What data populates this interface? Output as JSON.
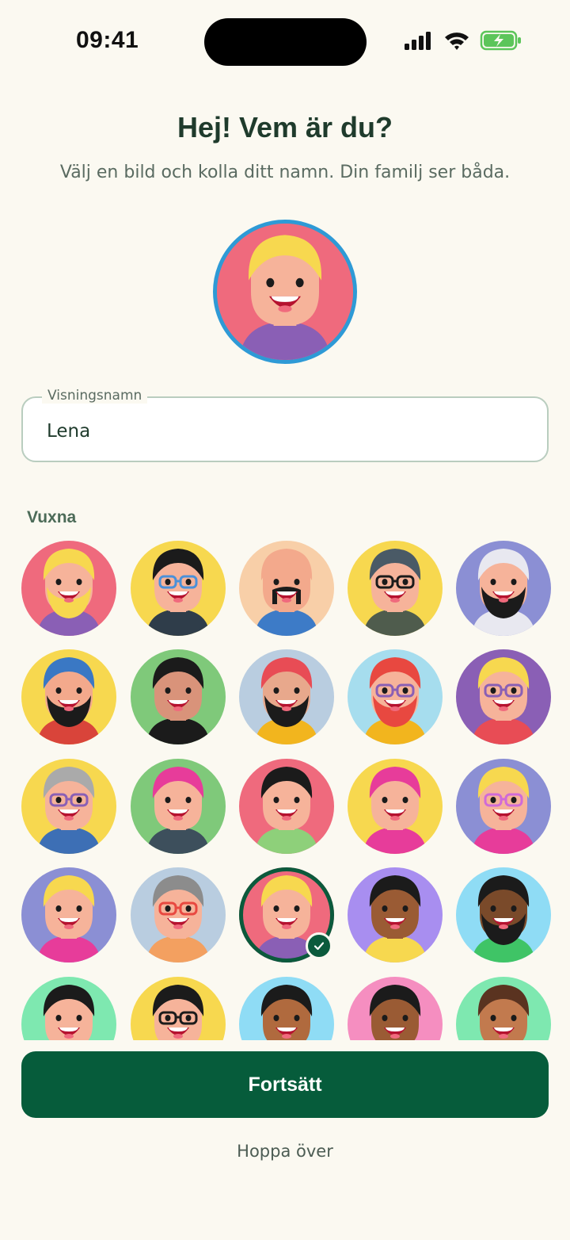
{
  "status_bar": {
    "time": "09:41",
    "icons": [
      "signal-icon",
      "wifi-icon",
      "battery-charging-icon"
    ]
  },
  "header": {
    "title": "Hej! Vem är du?",
    "subtitle": "Välj en bild och kolla ditt namn. Din familj ser båda."
  },
  "name_field": {
    "label": "Visningsnamn",
    "value": "Lena"
  },
  "section": {
    "label": "Vuxna"
  },
  "avatars": [
    {
      "bg": "#ef6a7d",
      "skin": "#f6b39a",
      "hair": "#f7d84f",
      "shirt": "#8a5fb5",
      "beard": "#f7d84f"
    },
    {
      "bg": "#f7d84f",
      "skin": "#f6b39a",
      "hair": "#1b1b1b",
      "shirt": "#2f3d4a",
      "glasses": "#4a90d9"
    },
    {
      "bg": "#f8cfa8",
      "skin": "#f3a98c",
      "hair": "#f3a98c",
      "shirt": "#3d7bc7",
      "mustache": "#1b1b1b"
    },
    {
      "bg": "#f7d84f",
      "skin": "#f6b39a",
      "hair": "#4a5a66",
      "shirt": "#4f5c4d",
      "glasses": "#1b1b1b"
    },
    {
      "bg": "#8b8fd4",
      "skin": "#f6b39a",
      "hair": "#e8e8f0",
      "shirt": "#e8e8f0",
      "beard": "#1b1b1b"
    },
    {
      "bg": "#f7d84f",
      "skin": "#f3a98c",
      "hair": "#3a78c4",
      "shirt": "#d9443a",
      "beard": "#1b1b1b"
    },
    {
      "bg": "#7fc97a",
      "skin": "#d9937a",
      "hair": "#1b1b1b",
      "shirt": "#1b1b1b"
    },
    {
      "bg": "#b9cde0",
      "skin": "#e8a88c",
      "hair": "#e84c55",
      "shirt": "#f2b51e",
      "beard": "#1b1b1b"
    },
    {
      "bg": "#a6ddee",
      "skin": "#f6b39a",
      "hair": "#e84840",
      "shirt": "#f2b51e",
      "beard": "#e84840",
      "glasses": "#8a5fb5"
    },
    {
      "bg": "#8a5fb5",
      "skin": "#f6b39a",
      "hair": "#f7d84f",
      "shirt": "#e84c55",
      "glasses": "#8a5fb5"
    },
    {
      "bg": "#f7d84f",
      "skin": "#f6b39a",
      "hair": "#aaaaaa",
      "shirt": "#3d6fb5",
      "glasses": "#8a5fb5"
    },
    {
      "bg": "#7fc97a",
      "skin": "#f6b39a",
      "hair": "#e73c9a",
      "shirt": "#3d4f5c"
    },
    {
      "bg": "#ef6a7d",
      "skin": "#f6b39a",
      "hair": "#1b1b1b",
      "shirt": "#8ed07a"
    },
    {
      "bg": "#f7d84f",
      "skin": "#f6b39a",
      "hair": "#e73c9a",
      "shirt": "#e73c9a"
    },
    {
      "bg": "#8b8fd4",
      "skin": "#f6b39a",
      "hair": "#f7d84f",
      "shirt": "#e73c9a",
      "glasses": "#d06ad8"
    },
    {
      "bg": "#8b8fd4",
      "skin": "#f6b39a",
      "hair": "#f7d84f",
      "shirt": "#e73c9a"
    },
    {
      "bg": "#b9cde0",
      "skin": "#f6b39a",
      "hair": "#8c8c8c",
      "shirt": "#f3a060",
      "glasses": "#e84840"
    },
    {
      "bg": "#ef6a7d",
      "skin": "#f6b39a",
      "hair": "#f7d84f",
      "shirt": "#8a5fb5",
      "selected": true
    },
    {
      "bg": "#a88ef0",
      "skin": "#9a5b34",
      "hair": "#1b1b1b",
      "shirt": "#f7d84f"
    },
    {
      "bg": "#8fdcf5",
      "skin": "#7a4a2a",
      "hair": "#1b1b1b",
      "shirt": "#3fc466",
      "beard": "#1b1b1b"
    },
    {
      "bg": "#7ee8b0",
      "skin": "#f6b39a",
      "hair": "#1b1b1b",
      "shirt": "#e84c55"
    },
    {
      "bg": "#f7d84f",
      "skin": "#f6b39a",
      "hair": "#1b1b1b",
      "shirt": "#3d6fb5",
      "glasses": "#1b1b1b"
    },
    {
      "bg": "#8fdcf5",
      "skin": "#b06a3e",
      "hair": "#1b1b1b",
      "shirt": "#e84c55"
    },
    {
      "bg": "#f58ec0",
      "skin": "#9a5b34",
      "hair": "#1b1b1b",
      "shirt": "#3d6fb5"
    },
    {
      "bg": "#7ee8b0",
      "skin": "#c27a4e",
      "hair": "#5a3320",
      "shirt": "#e84c55"
    }
  ],
  "actions": {
    "continue_label": "Fortsätt",
    "skip_label": "Hoppa över"
  },
  "colors": {
    "primary": "#065c3b",
    "accent_ring": "#2e9ad6",
    "background": "#fbf9f1"
  }
}
